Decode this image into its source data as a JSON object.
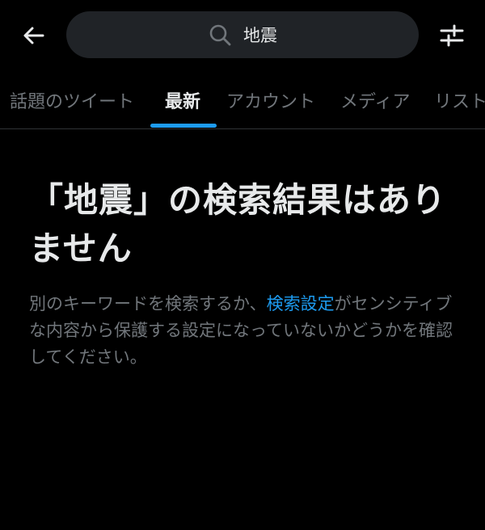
{
  "header": {
    "search_query": "地震"
  },
  "tabs": [
    {
      "label": "話題のツイート",
      "active": false
    },
    {
      "label": "最新",
      "active": true
    },
    {
      "label": "アカウント",
      "active": false
    },
    {
      "label": "メディア",
      "active": false
    },
    {
      "label": "リスト",
      "active": false
    }
  ],
  "empty_state": {
    "title": "「地震」の検索結果はありません",
    "body_before": "別のキーワードを検索するか、",
    "link_text": "検索設定",
    "body_after": "がセンシティブな内容から保護する設定になっていないかどうかを確認してください。"
  },
  "colors": {
    "background": "#000000",
    "search_field": "#202327",
    "accent": "#1d9bf0",
    "text_primary": "#e7e9ea",
    "text_secondary": "#71767b"
  },
  "icons": {
    "back": "arrow-left-icon",
    "search": "search-icon",
    "filter": "sliders-icon"
  }
}
